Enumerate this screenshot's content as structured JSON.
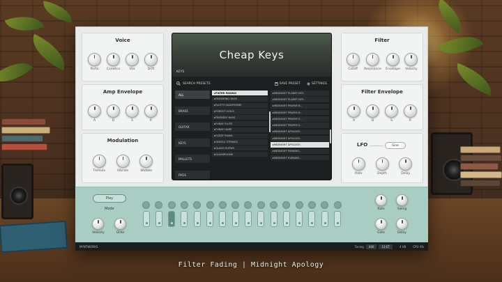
{
  "caption": "Filter Fading | Midnight Apology",
  "panels": {
    "voice": {
      "title": "Voice",
      "knobs": [
        "Porta",
        "Conetics",
        "Vox",
        "Drift"
      ]
    },
    "amp_envelope": {
      "title": "Amp Envelope",
      "knobs": [
        "A",
        "D",
        "S",
        "R"
      ]
    },
    "modulation": {
      "title": "Modulation",
      "knobs": [
        "Tremolo",
        "Vibrato",
        "Wobble"
      ]
    },
    "filter": {
      "title": "Filter",
      "knobs": [
        "Cutoff",
        "Resonance",
        "Envelope",
        "Velocity"
      ]
    },
    "filter_envelope": {
      "title": "Filter Envelope",
      "knobs": [
        "A",
        "D",
        "S",
        "R"
      ]
    },
    "lfo": {
      "title": "LFO",
      "toggle_label": "Sine",
      "knobs": [
        "Rate",
        "Depth",
        "Delay"
      ]
    }
  },
  "browser": {
    "title": "Cheap Keys",
    "tag": "KEYS",
    "search_placeholder": "SEARCH PRESETS",
    "save_label": "SAVE PRESET",
    "settings_label": "SETTINGS",
    "categories": [
      "ALL",
      "BRASS",
      "GUITAR",
      "KEYS",
      "MALLETS",
      "PADS",
      "PLUCKS"
    ],
    "active_category": 0,
    "presets": [
      "FILTER FADING",
      "FINGERING BASS",
      "FLUTTY SAXOPHONE",
      "FOREST VOICE",
      "FRIENDLY BASS",
      "FUNKY FLUTE",
      "FUNKY HARP",
      "FUZZY PIANO",
      "GENTLE STRINGS",
      "GLASS GUITAR",
      "GLASSPHONE"
    ],
    "active_preset": 0,
    "favorites": [
      "MIDNIGHT PLANET KEY..",
      "MIDNIGHT PLANET KEY..",
      "MIDNIGHT PRAYER B..",
      "MIDNIGHT PRAYER B..",
      "MIDNIGHT PRAYER S..",
      "MIDNIGHT PRAYER S..",
      "MIDNIGHT APOLOGY..",
      "MIDNIGHT APOLOGY..",
      "MIDNIGHT APOLOGY..",
      "MIDNIGHT PARKING..",
      "MIDNIGHT EVENING.."
    ],
    "active_favorite": 8
  },
  "sequencer": {
    "play_label": "Play",
    "mode_label": "Mode",
    "left_knobs": [
      "Velocity",
      "Glide"
    ],
    "right_knobs_top": [
      "Rate",
      "Swing"
    ],
    "right_knobs_bottom": [
      "Gate",
      "Delay"
    ],
    "steps_on": [
      false,
      false,
      true,
      false,
      false,
      false,
      false,
      false,
      false,
      false,
      false,
      false,
      false,
      false,
      false,
      false
    ]
  },
  "status": {
    "brand": "MYNTWORKS",
    "tuning_label": "Tuning",
    "tuning_values": [
      "440",
      "12-ET"
    ],
    "voices_label": "4 VB",
    "cpu_label": "CPU 4%"
  }
}
